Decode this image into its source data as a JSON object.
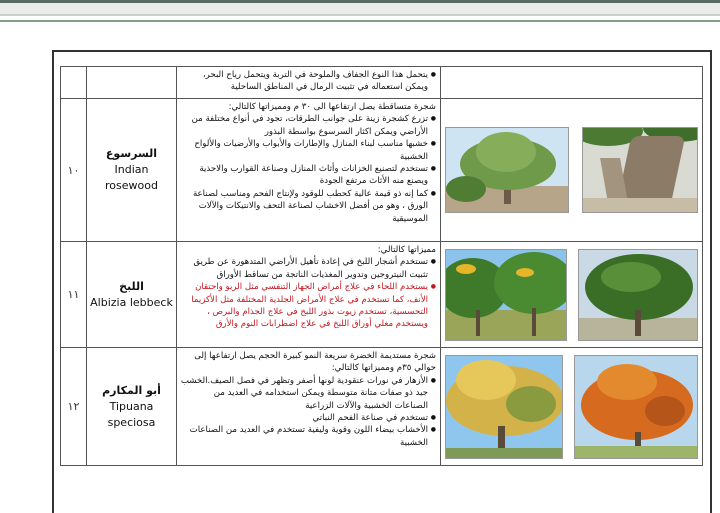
{
  "rows": [
    {
      "number": "",
      "name_ar": "",
      "name_en": "",
      "intro": "",
      "bullets": [
        {
          "text": "يتحمل هذا النوع الجفاف والملوحة في التربة ويتحمل رياح البحر، ويمكن استعماله في تثبيت الرمال في المناطق الساحلية",
          "red": false
        }
      ]
    },
    {
      "number": "١٠",
      "name_ar": "السرسوع",
      "name_en": "Indian rosewood",
      "intro": "شجرة متساقطة يصل ارتفاعها الى ٣٠ م ومميزاتها كالتالي:",
      "bullets": [
        {
          "text": "تزرع كشجرة زينة على جوانب الطرقات، تجود في أنواع مختلفة من الأراضي ويمكن اكثار السرسوع بواسطة البذور",
          "red": false
        },
        {
          "text": "خشبها مناسب لبناء المنازل والإطارات والأبواب والأرضيات والألواح الخشبية",
          "red": false
        },
        {
          "text": "تستخدم لتصنيع الخزانات وأثاث المنازل وصناعة القوارب والاحذية ويصنع منه الأثاث مرتفع الجودة",
          "red": false
        },
        {
          "text": "كما إنه ذو قيمة عالية كحطب للوقود ولإنتاج الفحم ومناسب لصناعة الورق ، وهو من أفضل الاخشاب لصناعة التحف والانتيكات والآلات الموسيقية",
          "red": false
        }
      ]
    },
    {
      "number": "١١",
      "name_ar": "اللبخ",
      "name_en": "Albizia lebbeck",
      "intro": "مميزاتها كالتالي:",
      "bullets": [
        {
          "text": "تستخدم أشجار اللبخ في إعادة تأهيل الأراضي المتدهورة عن طريق تثبيت النيتروجين وتدوير المغذيات الناتجة من تساقط الأوراق",
          "red": false
        },
        {
          "text": "يستخدم اللحاء في علاج أمراض الجهاز التنفسي مثل الربو واحتقان الأنف، كما تستخدم في علاج الأمراض الجلدية المختلفة مثل الأكزيما التحسسية، تستخدم زيوت بذور اللبخ في علاج الجذام والبرص ، ويستخدم مغلي أوراق اللبخ في علاج اضطرابات النوم والأرق",
          "red": true
        }
      ]
    },
    {
      "number": "١٢",
      "name_ar": "أبو المكارم",
      "name_en": "Tipuana speciosa",
      "intro": "شجرة مستديمة الخضرة سريعة النمو كبيرة الحجم يصل ارتفاعها إلى حوالي ٣٥م ومميزاتها كالتالي:",
      "bullets": [
        {
          "text": "الأزهار في نورات عنقودية لونها أصفر وتظهر في فصل الصيف.الخشب جيد ذو صفات متانة متوسطة ويمكن استخدامه في العديد من الصناعات الخشبية والآلات الزراعية",
          "red": false
        },
        {
          "text": "تستخدم في صناعة الفحم النباتي",
          "red": false
        },
        {
          "text": "الأخشاب بيضاء اللون وقوية وليفية تستخدم في العديد من الصناعات الخشبية",
          "red": false
        }
      ]
    }
  ],
  "photo_colors": {
    "sky": "#8cc3ea",
    "foliage_green": "#3f7a2a",
    "foliage_light": "#7fb04a",
    "flower_yellow": "#e6b52a",
    "flower_orange": "#d66a1f",
    "trunk": "#6b5a48",
    "ground": "#b9a98a"
  }
}
